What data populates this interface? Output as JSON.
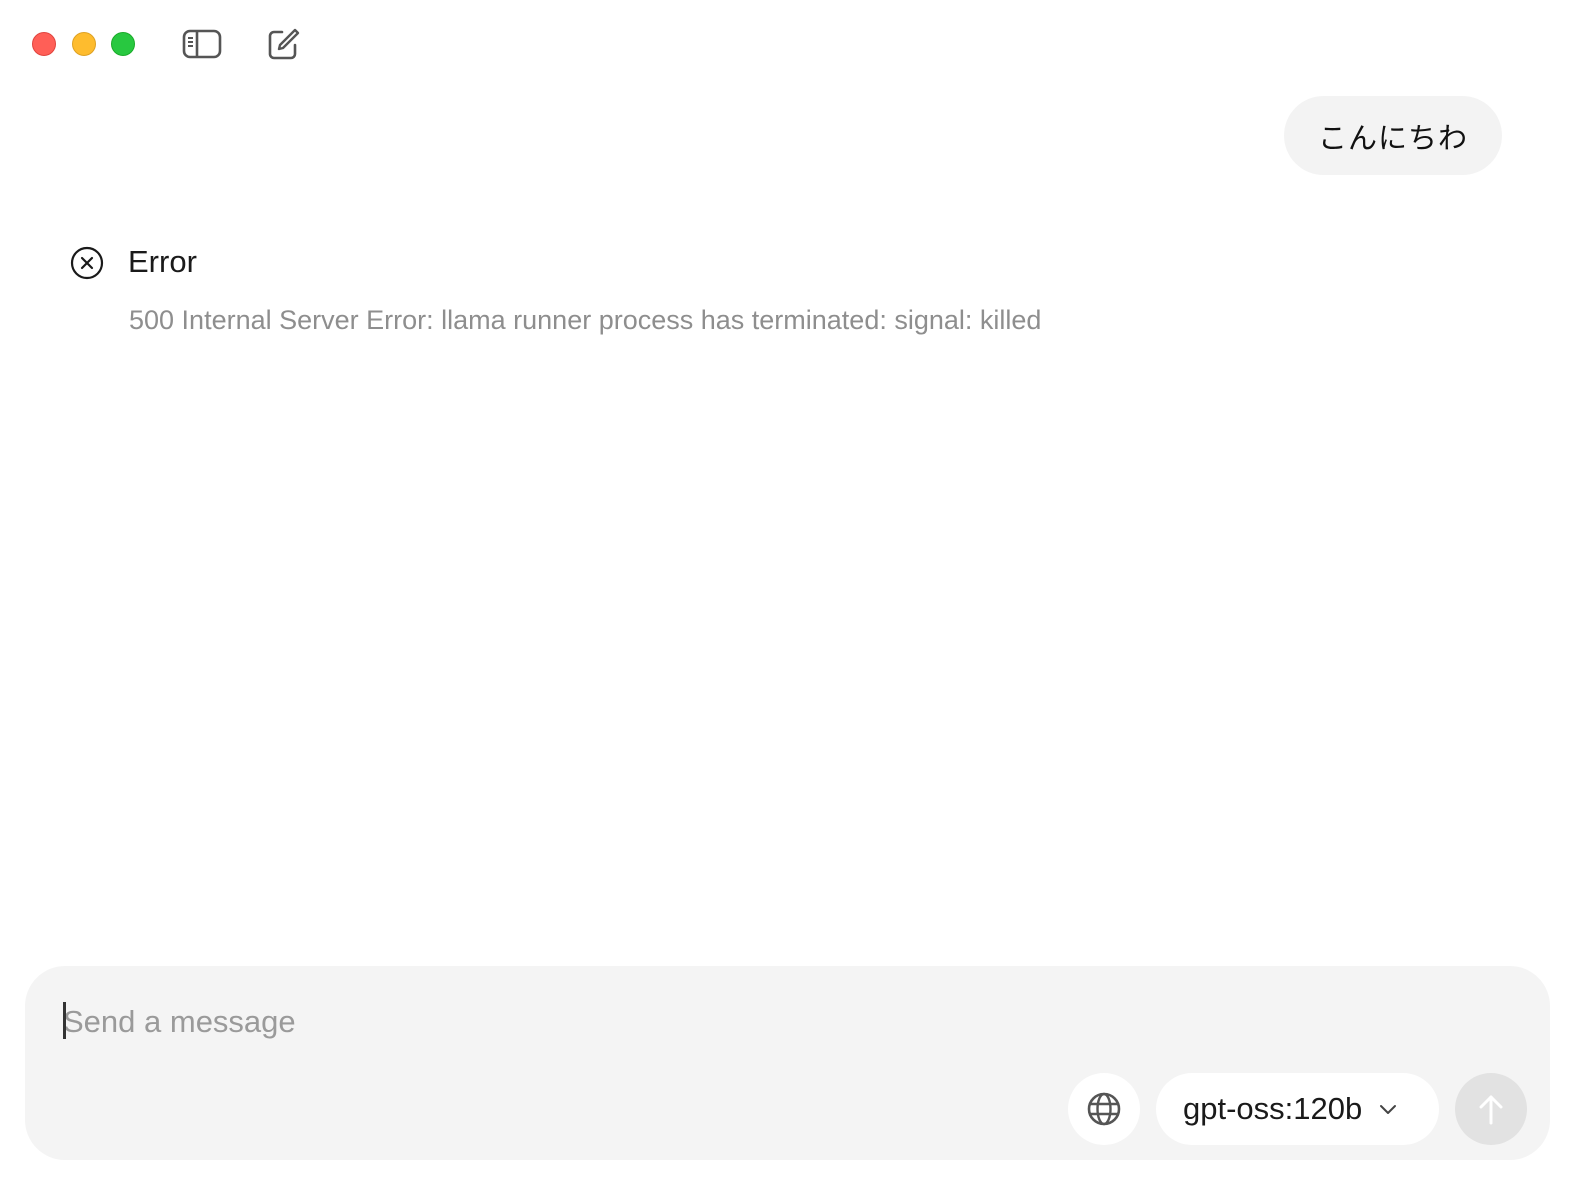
{
  "window": {
    "traffic_lights": {
      "close_color": "#ff5f57",
      "minimize_color": "#febc2e",
      "maximize_color": "#28c840"
    },
    "toolbar": {
      "sidebar_icon": "sidebar-toggle-icon",
      "new_chat_icon": "compose-icon"
    }
  },
  "conversation": {
    "user_message": "こんにちわ",
    "error": {
      "icon": "error-circle-x-icon",
      "title": "Error",
      "message": "500 Internal Server Error: llama runner process has terminated: signal: killed"
    }
  },
  "composer": {
    "placeholder": "Send a message",
    "value": "",
    "web_search_icon": "globe-icon",
    "model": "gpt-oss:120b",
    "model_dropdown_icon": "chevron-down-icon",
    "send_icon": "arrow-up-icon",
    "send_enabled": false
  }
}
